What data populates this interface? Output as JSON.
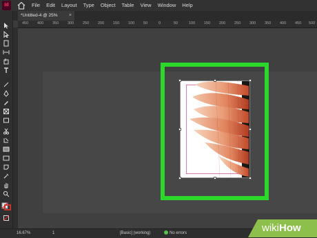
{
  "app": {
    "logo": "Id"
  },
  "menu": [
    "File",
    "Edit",
    "Layout",
    "Type",
    "Object",
    "Table",
    "View",
    "Window",
    "Help"
  ],
  "document_tab": {
    "label": "*Untitled-4 @ 25%",
    "close": "×"
  },
  "ruler": {
    "ticks": [
      "450",
      "400",
      "350",
      "300",
      "250",
      "200",
      "150",
      "100",
      "50",
      "0",
      "50",
      "100",
      "150",
      "200",
      "250",
      "300",
      "350",
      "400",
      "450",
      "500"
    ]
  },
  "status": {
    "zoom": "16.67%",
    "page": "1",
    "style": "[Basic] (working)",
    "errors": "No errors"
  },
  "watermark": {
    "part1": "wiki",
    "part2": "How"
  },
  "colors": {
    "highlight": "#2cd829",
    "menubar": "#323232",
    "pasteboard": "#404040"
  },
  "icons": [
    "home-icon",
    "selection-tool-icon",
    "direct-selection-tool-icon",
    "page-tool-icon",
    "gap-tool-icon",
    "content-collector-icon",
    "type-tool-icon",
    "line-tool-icon",
    "pen-tool-icon",
    "pencil-tool-icon",
    "rectangle-frame-tool-icon",
    "rectangle-tool-icon",
    "scissors-tool-icon",
    "free-transform-tool-icon",
    "gradient-tool-icon",
    "note-tool-icon",
    "eyedropper-tool-icon",
    "hand-tool-icon",
    "zoom-tool-icon",
    "fill-stroke-icon"
  ]
}
